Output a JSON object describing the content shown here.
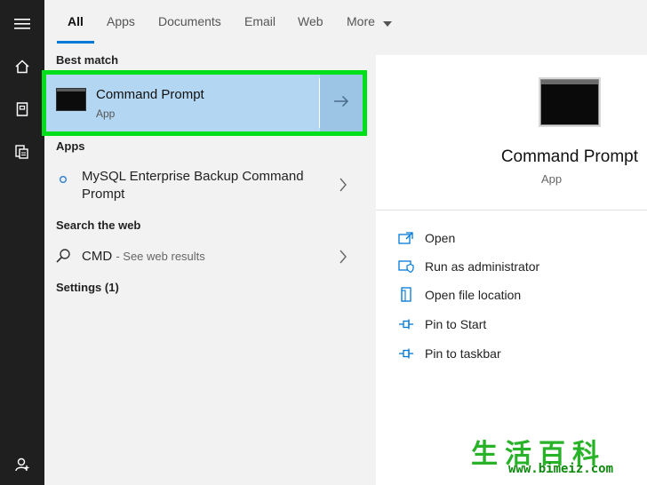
{
  "tabs": [
    {
      "label": "All"
    },
    {
      "label": "Apps"
    },
    {
      "label": "Documents"
    },
    {
      "label": "Email"
    },
    {
      "label": "Web"
    },
    {
      "label": "More"
    }
  ],
  "sections": {
    "best_match": "Best match",
    "apps": "Apps",
    "web": "Search the web",
    "settings": "Settings (1)"
  },
  "best_match": {
    "title": "Command Prompt",
    "subtitle": "App"
  },
  "apps": [
    {
      "label_line1": "MySQL Enterprise Backup Command",
      "label_line2": "Prompt"
    }
  ],
  "web": {
    "query": "CMD",
    "suffix": "- See web results"
  },
  "detail": {
    "title": "Command Prompt",
    "subtitle": "App",
    "actions": [
      {
        "label": "Open",
        "icon": "open-icon"
      },
      {
        "label": "Run as administrator",
        "icon": "shield-icon"
      },
      {
        "label": "Open file location",
        "icon": "file-location-icon"
      },
      {
        "label": "Pin to Start",
        "icon": "pin-icon"
      },
      {
        "label": "Pin to taskbar",
        "icon": "pin-icon"
      }
    ]
  },
  "watermark": {
    "chars": "生活百科",
    "url": "www.bimeiz.com"
  },
  "colors": {
    "accent": "#0078d7",
    "highlight": "#00e01a",
    "selected": "#b3d7f2",
    "rail": "#1f1f1f"
  }
}
